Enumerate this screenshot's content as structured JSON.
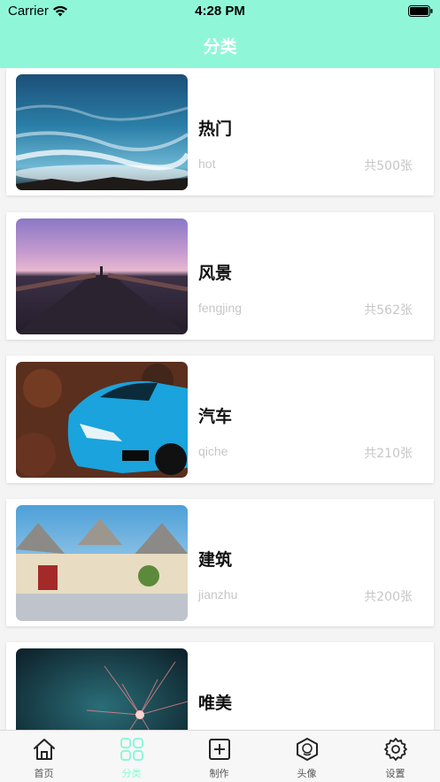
{
  "status_bar": {
    "carrier": "Carrier",
    "time": "4:28 PM"
  },
  "header": {
    "title": "分类"
  },
  "colors": {
    "accent": "#8ff7d7",
    "inactive": "#555555"
  },
  "categories": [
    {
      "name": "热门",
      "pinyin": "hot",
      "count": "共500张",
      "image": "ocean-waves"
    },
    {
      "name": "风景",
      "pinyin": "fengjing",
      "count": "共562张",
      "image": "pier-sunset"
    },
    {
      "name": "汽车",
      "pinyin": "qiche",
      "count": "共210张",
      "image": "blue-sports-car"
    },
    {
      "name": "建筑",
      "pinyin": "jianzhu",
      "count": "共200张",
      "image": "trulli-house"
    },
    {
      "name": "唯美",
      "pinyin": "",
      "count": "",
      "image": "fireworks"
    }
  ],
  "tabs": [
    {
      "label": "首页",
      "icon": "home-icon",
      "active": false
    },
    {
      "label": "分类",
      "icon": "grid-icon",
      "active": true
    },
    {
      "label": "制作",
      "icon": "plus-square-icon",
      "active": false
    },
    {
      "label": "头像",
      "icon": "avatar-hex-icon",
      "active": false
    },
    {
      "label": "设置",
      "icon": "gear-icon",
      "active": false
    }
  ]
}
